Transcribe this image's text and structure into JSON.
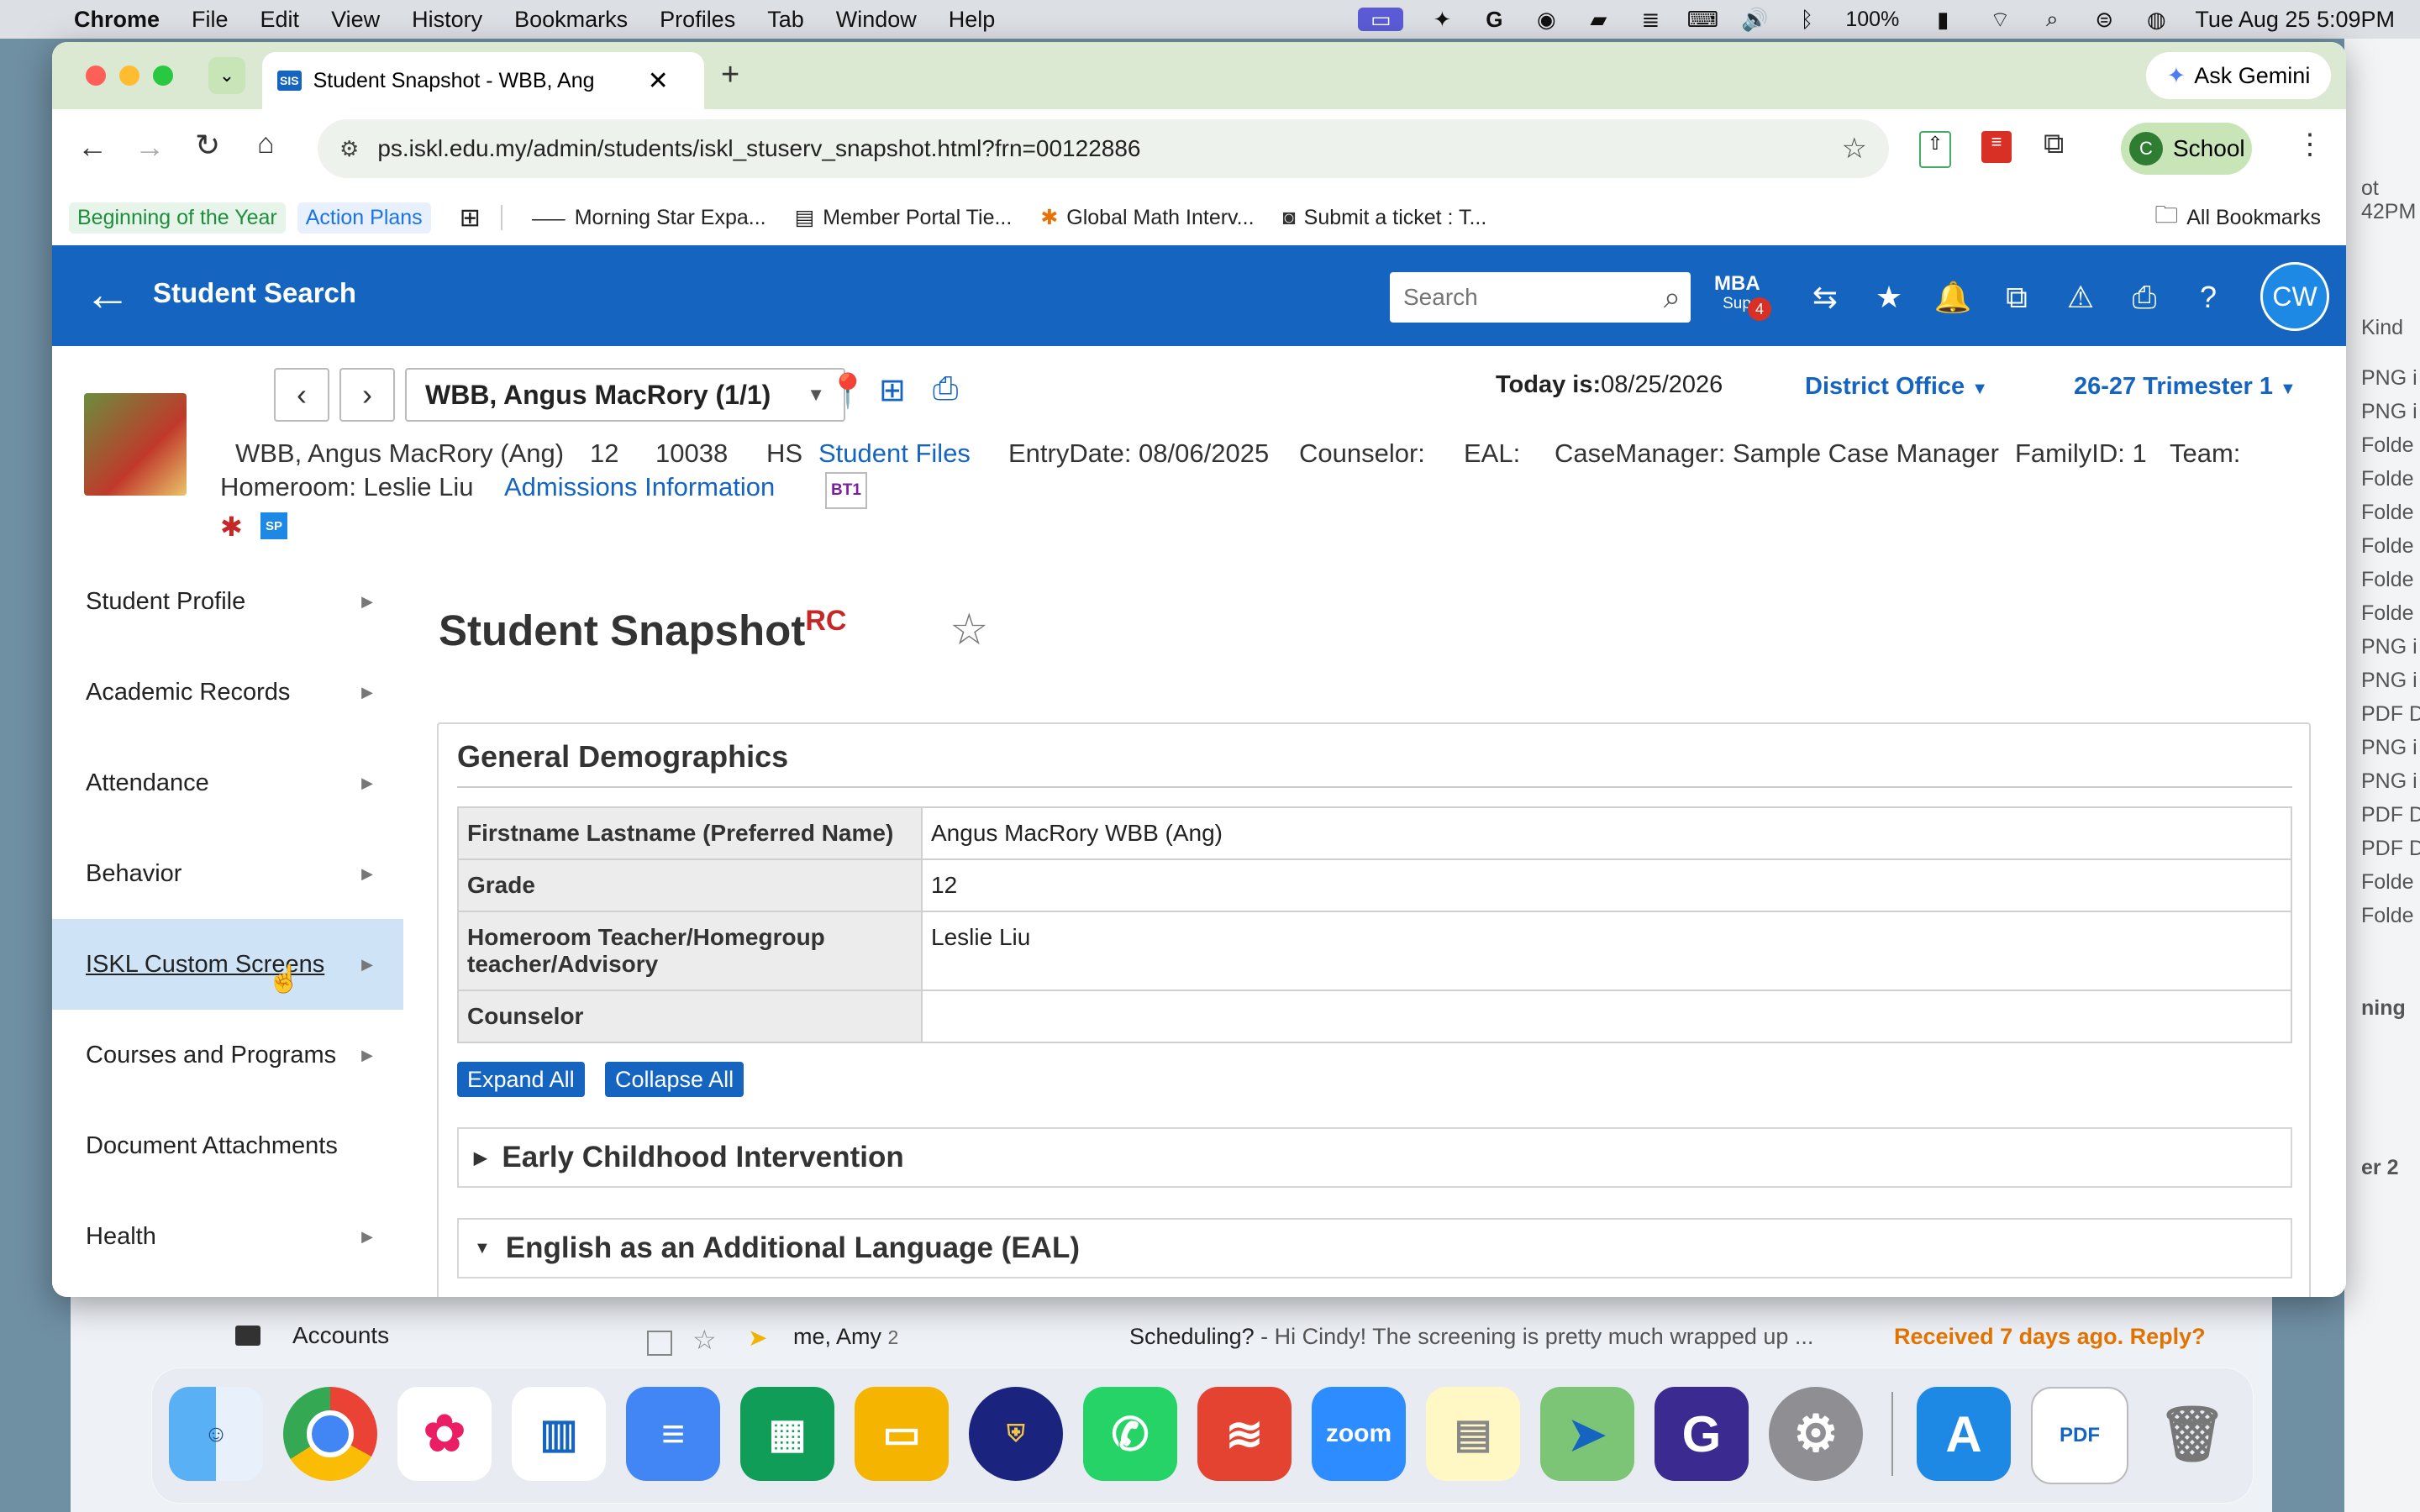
{
  "menubar": {
    "app": "Chrome",
    "items": [
      "File",
      "Edit",
      "View",
      "History",
      "Bookmarks",
      "Profiles",
      "Tab",
      "Window",
      "Help"
    ],
    "battery": "100%",
    "datetime": "Tue Aug 25  5:09PM"
  },
  "browser": {
    "tab_title": "Student Snapshot - WBB, Ang",
    "url": "ps.iskl.edu.my/admin/students/iskl_stuserv_snapshot.html?frn=00122886",
    "ask_gemini": "Ask Gemini",
    "profile": "School",
    "profile_initial": "C",
    "bookmarks": [
      "Beginning of the Year",
      "Action Plans",
      "Morning Star Expa...",
      "Member Portal Tie...",
      "Global Math Interv...",
      "Submit a ticket : T..."
    ],
    "all_bookmarks": "All Bookmarks"
  },
  "header": {
    "back_label": "Student Search",
    "search_placeholder": "Search",
    "mba_label": "MBA",
    "mba_sub": "Sup",
    "mba_badge": "4",
    "user_initials": "CW"
  },
  "student": {
    "selector": "WBB, Angus MacRory  (1/1)",
    "today_label": "Today is:",
    "today": "08/25/2026",
    "district": "District Office",
    "term": "26-27 Trimester 1",
    "name": "WBB, Angus MacRory (Ang)",
    "grade": "12",
    "id": "10038",
    "school": "HS",
    "files_link": "Student Files",
    "entry": "EntryDate: 08/06/2025",
    "counselor": "Counselor:",
    "eal": "EAL:",
    "casemanager": "CaseManager: Sample Case Manager",
    "family": "FamilyID: 1",
    "team": "Team:",
    "homeroom": "Homeroom: Leslie Liu",
    "admissions_link": "Admissions Information",
    "bt_badge": "BT1",
    "sp_badge": "SP"
  },
  "leftnav": [
    {
      "label": "Student Profile",
      "arrow": true
    },
    {
      "label": "Academic Records",
      "arrow": true
    },
    {
      "label": "Attendance",
      "arrow": true
    },
    {
      "label": "Behavior",
      "arrow": true
    },
    {
      "label": "ISKL Custom Screens",
      "arrow": true
    },
    {
      "label": "Courses and Programs",
      "arrow": true
    },
    {
      "label": "Document Attachments",
      "arrow": false
    },
    {
      "label": "Health",
      "arrow": true
    }
  ],
  "content": {
    "title": "Student Snapshot",
    "title_badge": "RC",
    "section_title": "General Demographics",
    "rows": [
      {
        "key": "Firstname Lastname (Preferred Name)",
        "value": "Angus MacRory WBB (Ang)"
      },
      {
        "key": "Grade",
        "value": "12"
      },
      {
        "key": "Homeroom Teacher/Homegroup teacher/Advisory",
        "value": "Leslie Liu"
      },
      {
        "key": "Counselor",
        "value": ""
      }
    ],
    "expand_all": "Expand All",
    "collapse_all": "Collapse All",
    "sections": [
      "Early Childhood Intervention",
      "English as an Additional Language (EAL)"
    ]
  },
  "background": {
    "accounts": "Accounts",
    "mail_from": "me, Amy",
    "mail_count": "2",
    "mail_subject": "Scheduling?",
    "mail_snippet": " - Hi Cindy! The screening is pretty much wrapped up ...",
    "mail_status": "Received 7 days ago. Reply?",
    "right_labels": [
      "ot",
      "42PM",
      "Kind",
      "PNG i",
      "PNG i",
      "Folde",
      "Folde",
      "Folde",
      "Folde",
      "Folde",
      "Folde",
      "PNG i",
      "PNG i",
      "PDF D",
      "PNG i",
      "PNG i",
      "PDF D",
      "PDF D",
      "Folde",
      "Folde",
      "ning",
      "er 2"
    ]
  },
  "dock": [
    "Finder",
    "Chrome",
    "Photos",
    "Keynote",
    "Docs",
    "Sheets",
    "Slides",
    "School",
    "WhatsApp",
    "Todoist",
    "Zoom",
    "Notes",
    "Maps",
    "Grammarly",
    "Settings",
    "App Store",
    "Preview",
    "Trash"
  ]
}
